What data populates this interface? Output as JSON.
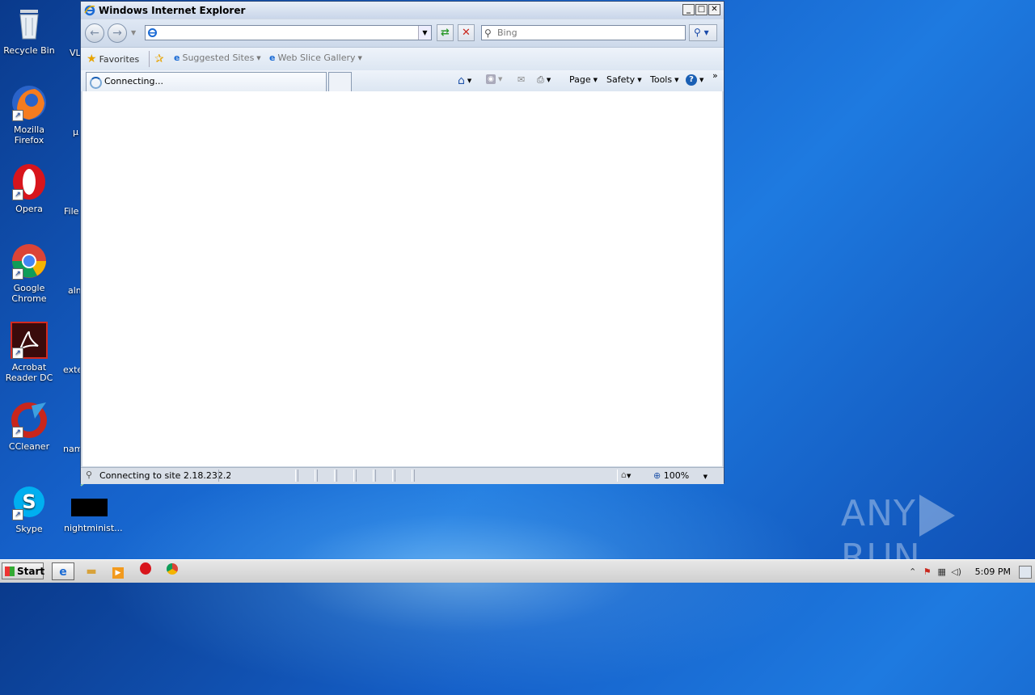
{
  "desktop": {
    "icons": [
      {
        "label": "Recycle Bin",
        "icon": "recycle-bin-icon"
      },
      {
        "label": "Mozilla Firefox",
        "icon": "firefox-icon"
      },
      {
        "label": "Opera",
        "icon": "opera-icon"
      },
      {
        "label": "Google Chrome",
        "icon": "chrome-icon"
      },
      {
        "label": "Acrobat Reader DC",
        "icon": "acrobat-icon"
      },
      {
        "label": "CCleaner",
        "icon": "ccleaner-icon"
      },
      {
        "label": "Skype",
        "icon": "skype-icon"
      }
    ],
    "partial_labels": [
      "VL",
      "µ",
      "File",
      "alm",
      "exte",
      "nam",
      "nightminist..."
    ]
  },
  "ie": {
    "title": "Windows Internet Explorer",
    "address_value": "",
    "search_placeholder": "Bing",
    "favorites_label": "Favorites",
    "suggested_sites": "Suggested Sites",
    "web_slice_gallery": "Web Slice Gallery",
    "tab_label": "Connecting...",
    "commands": {
      "page": "Page",
      "safety": "Safety",
      "tools": "Tools"
    },
    "status_text": "Connecting to site 2.18.232.2",
    "zoom": "100%"
  },
  "taskbar": {
    "start_label": "Start",
    "clock": "5:09 PM"
  },
  "watermark": {
    "left": "ANY",
    "right": "RUN"
  }
}
